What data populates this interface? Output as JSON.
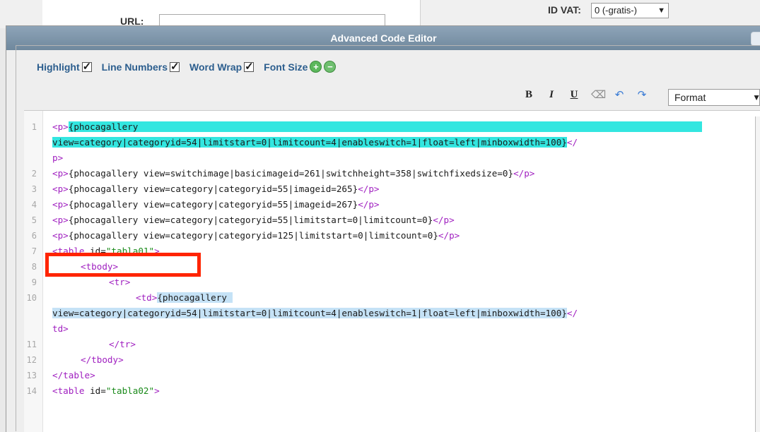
{
  "background_form": {
    "url_label": "URL:",
    "id_vat_label": "ID VAT:",
    "id_vat_value": "0 (-gratis-)"
  },
  "dialog": {
    "title": "Advanced Code Editor"
  },
  "options": {
    "highlight": "Highlight",
    "line_numbers": "Line Numbers",
    "word_wrap": "Word Wrap",
    "font_size": "Font Size"
  },
  "toolbar": {
    "bold": "B",
    "italic": "I",
    "underline": "U",
    "format": "Format"
  },
  "code": {
    "line_numbers": [
      "1",
      "2",
      "3",
      "4",
      "5",
      "6",
      "7",
      "8",
      "9",
      "10",
      "11",
      "12",
      "13",
      "14"
    ],
    "l1a_text": "{phocagallery",
    "l1b_text": "view=category|categoryid=54|limitstart=0|limitcount=4|enableswitch=1|float=left|minboxwidth=100}",
    "l2_text": "{phocagallery view=switchimage|basicimageid=261|switchheight=358|switchfixedsize=0}",
    "l3_text": "{phocagallery view=category|categoryid=55|imageid=265}",
    "l4_text": "{phocagallery view=category|categoryid=55|imageid=267}",
    "l5_text": "{phocagallery view=category|categoryid=55|limitstart=0|limitcount=0}",
    "l6_text": "{phocagallery view=category|categoryid=125|limitstart=0|limitcount=0}",
    "l7_attr_value": "\"tabla01\"",
    "l10a_text": "{phocagallery ",
    "l10b_text": "view=category|categoryid=54|limitstart=0|limitcount=4|enableswitch=1|float=left|minboxwidth=100}",
    "l14_attr_value": "\"tabla02\""
  },
  "colors": {
    "tag": "#a020c0",
    "value": "#1a8a1a",
    "highlight_cyan": "#33e6e0",
    "highlight_blue": "#c5e2f6",
    "annotation_red": "#ff2400"
  }
}
